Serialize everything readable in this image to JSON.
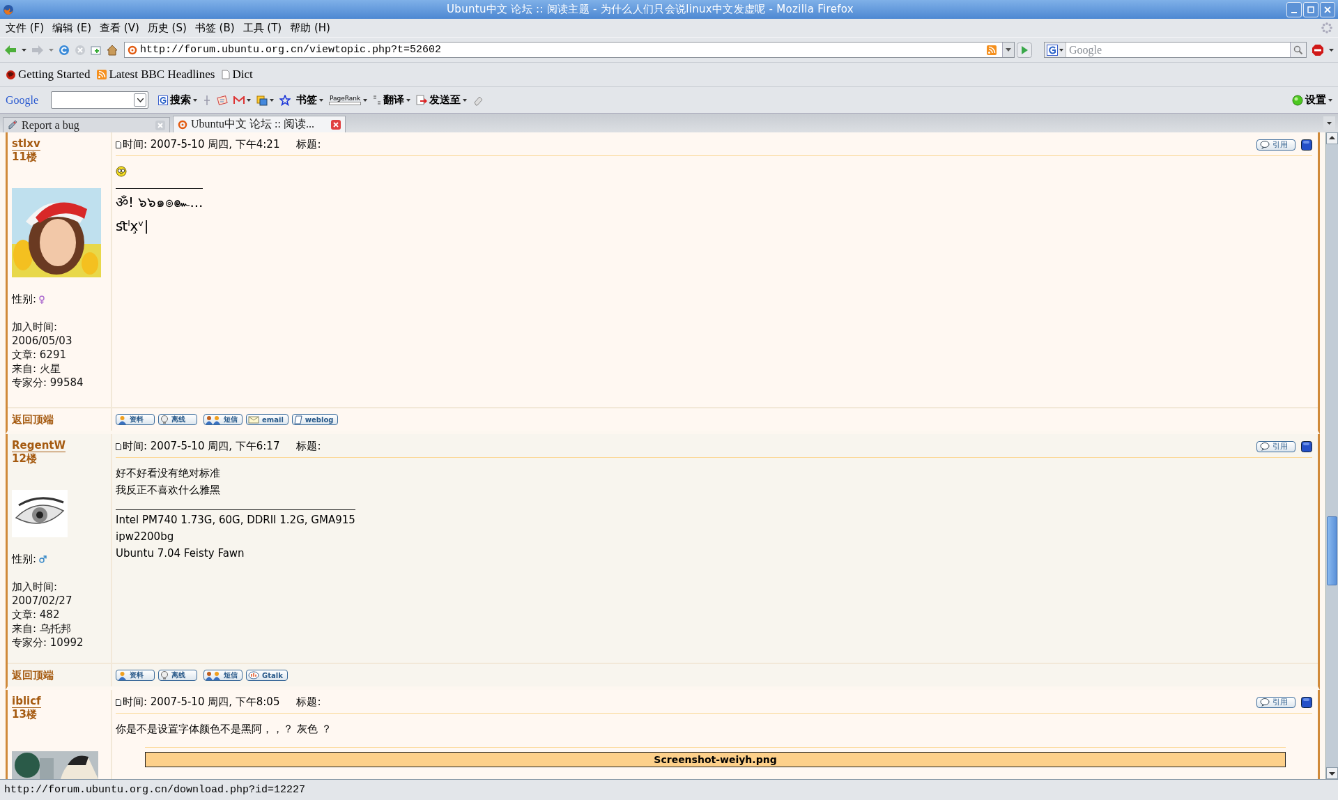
{
  "window": {
    "title": "Ubuntu中文  论坛 :: 阅读主题 - 为什么人们只会说linux中文发虚呢 - Mozilla  Firefox"
  },
  "menu": [
    "文件 (F)",
    "编辑 (E)",
    "查看 (V)",
    "历史 (S)",
    "书签 (B)",
    "工具 (T)",
    "帮助 (H)"
  ],
  "navigation": {
    "address": "http://forum.ubuntu.org.cn/viewtopic.php?t=52602",
    "search_placeholder": "Google"
  },
  "bookmarks": [
    {
      "label": "Getting Started",
      "kind": "firefox"
    },
    {
      "label": "Latest BBC Headlines",
      "kind": "feed"
    },
    {
      "label": "Dict",
      "kind": "page"
    }
  ],
  "google_toolbar": {
    "logo": "Google",
    "search_button": "搜索",
    "bookmarks_button": "书签",
    "pagerank": "PageRank",
    "translate_button": "翻译",
    "send_button": "发送至",
    "settings_button": "设置"
  },
  "tabs": [
    {
      "label": "Report a bug",
      "selected": false
    },
    {
      "label": "Ubuntu中文 论坛 :: 阅读...",
      "selected": true
    }
  ],
  "posts": [
    {
      "author": "stlxv",
      "floor": "11楼",
      "avatar": {
        "kind": "picture"
      },
      "gender_label": "性别:",
      "female": true,
      "stats": [
        "加入时间:",
        "2006/05/03",
        "文章: 6291",
        "来自: 火星",
        "专家分: 99584"
      ],
      "back_to_top": "返回顶端",
      "time": "时间: 2007-5-10 周四, 下午4:21",
      "subject_label": "标题:",
      "quote_button": "引用",
      "body": [
        {
          "kind": "smiley"
        }
      ],
      "large_signature": true,
      "signature": [
        "ॐ! ๖๖๑๏๛...",
        "ﬆˡx̧ᵛ|"
      ],
      "buttons": [
        {
          "label": "资料",
          "kind": "profile"
        },
        {
          "label": "离线",
          "kind": "offline"
        },
        {
          "label": "短信",
          "kind": "message"
        },
        {
          "label": "email",
          "kind": "email"
        },
        {
          "label": "weblog",
          "kind": "weblog"
        }
      ]
    },
    {
      "author": "RegentW",
      "floor": "12楼",
      "avatar": {
        "kind": "picture"
      },
      "gender_label": "性别:",
      "female": false,
      "stats": [
        "加入时间:",
        "2007/02/27",
        "文章: 482",
        "来自: 乌托邦",
        "专家分: 10992"
      ],
      "back_to_top": "返回顶端",
      "time": "时间: 2007-5-10 周四, 下午6:17",
      "subject_label": "标题:",
      "quote_button": "引用",
      "body": [
        {
          "kind": "text",
          "text": "好不好看没有绝对标准"
        },
        {
          "kind": "text",
          "text": "我反正不喜欢什么雅黑"
        }
      ],
      "large_signature": false,
      "signature": [
        "Intel PM740 1.73G, 60G, DDRII 1.2G, GMA915",
        "ipw2200bg",
        "Ubuntu 7.04 Feisty Fawn"
      ],
      "buttons": [
        {
          "label": "资料",
          "kind": "profile"
        },
        {
          "label": "离线",
          "kind": "offline"
        },
        {
          "label": "短信",
          "kind": "message"
        },
        {
          "label": "Gtalk",
          "kind": "gtalk"
        }
      ]
    },
    {
      "author": "iblicf",
      "floor": "13楼",
      "avatar": {
        "kind": "picture"
      },
      "time": "时间: 2007-5-10 周四, 下午8:05",
      "subject_label": "标题:",
      "quote_button": "引用",
      "body": [
        {
          "kind": "text",
          "text": "你是不是设置字体颜色不是黑阿，，？ 灰色 ？"
        },
        {
          "kind": "attachment",
          "title": "Screenshot-weiyh.png"
        }
      ]
    }
  ],
  "status_bar": "http://forum.ubuntu.org.cn/download.php?id=12227"
}
